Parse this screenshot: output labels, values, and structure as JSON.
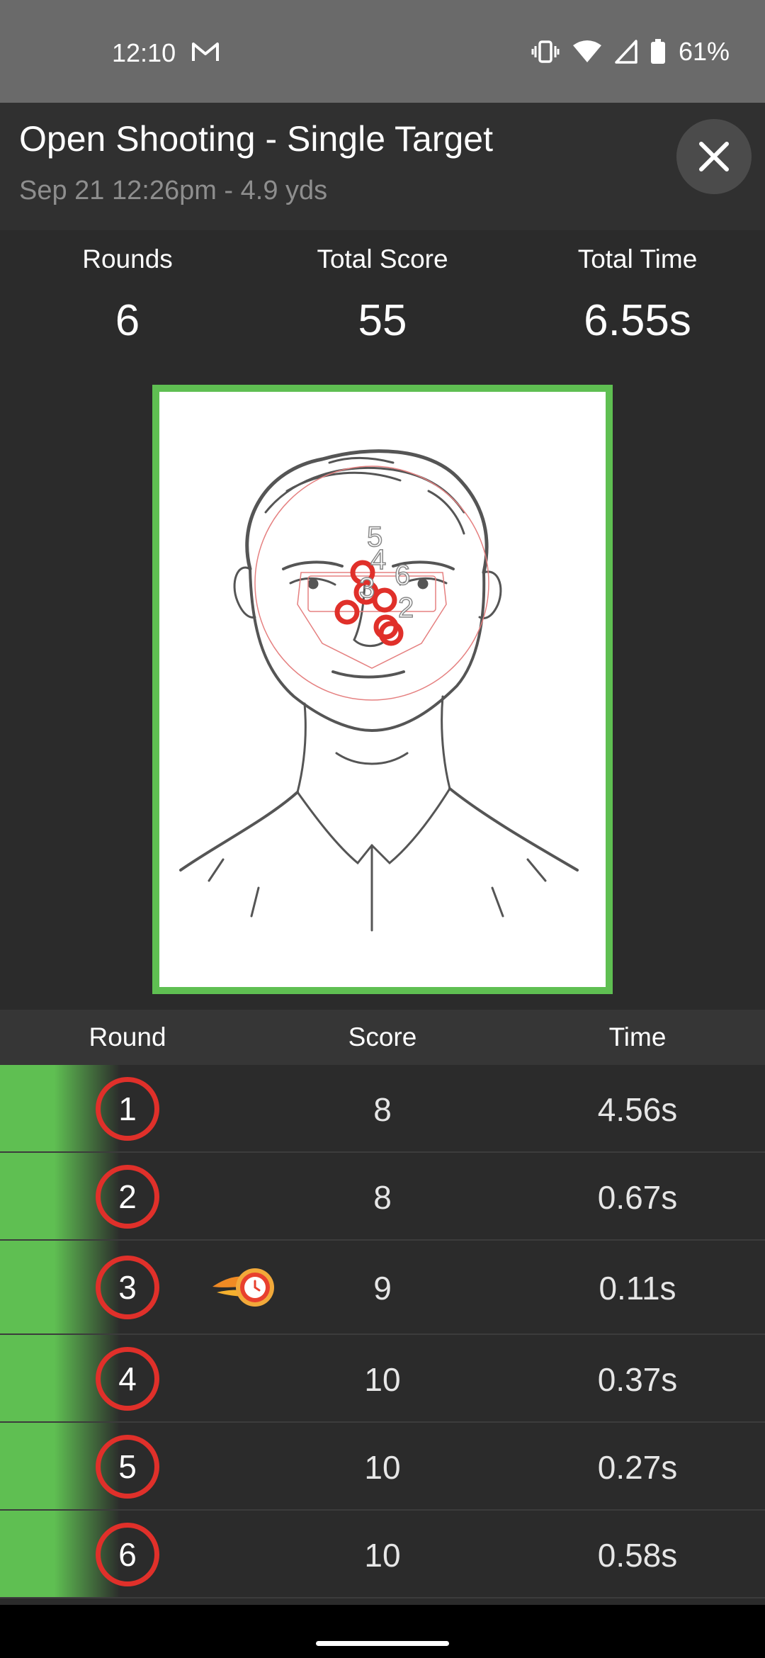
{
  "status_bar": {
    "time": "12:10",
    "battery_text": "61%",
    "icons": [
      "gmail-icon",
      "vibrate-icon",
      "wifi-icon",
      "signal-icon",
      "battery-icon"
    ]
  },
  "header": {
    "title": "Open Shooting - Single Target",
    "subtitle": "Sep 21 12:26pm - 4.9 yds",
    "close_icon": "close-icon"
  },
  "summary": {
    "rounds_label": "Rounds",
    "rounds_value": "6",
    "score_label": "Total Score",
    "score_value": "55",
    "time_label": "Total Time",
    "time_value": "6.55s"
  },
  "target": {
    "frame_color": "#5fbf52",
    "shot_color": "#e0302a",
    "shot_labels": [
      "5",
      "4",
      "6",
      "3",
      "2"
    ]
  },
  "table": {
    "headers": [
      "Round",
      "Score",
      "Time"
    ],
    "rows": [
      {
        "round": "1",
        "score": "8",
        "time": "4.56s",
        "fastest": false
      },
      {
        "round": "2",
        "score": "8",
        "time": "0.67s",
        "fastest": false
      },
      {
        "round": "3",
        "score": "9",
        "time": "0.11s",
        "fastest": true
      },
      {
        "round": "4",
        "score": "10",
        "time": "0.37s",
        "fastest": false
      },
      {
        "round": "5",
        "score": "10",
        "time": "0.27s",
        "fastest": false
      },
      {
        "round": "6",
        "score": "10",
        "time": "0.58s",
        "fastest": false
      }
    ]
  },
  "colors": {
    "accent_green": "#5fbf52",
    "ring_red": "#e0302a",
    "background": "#2b2b2b"
  }
}
